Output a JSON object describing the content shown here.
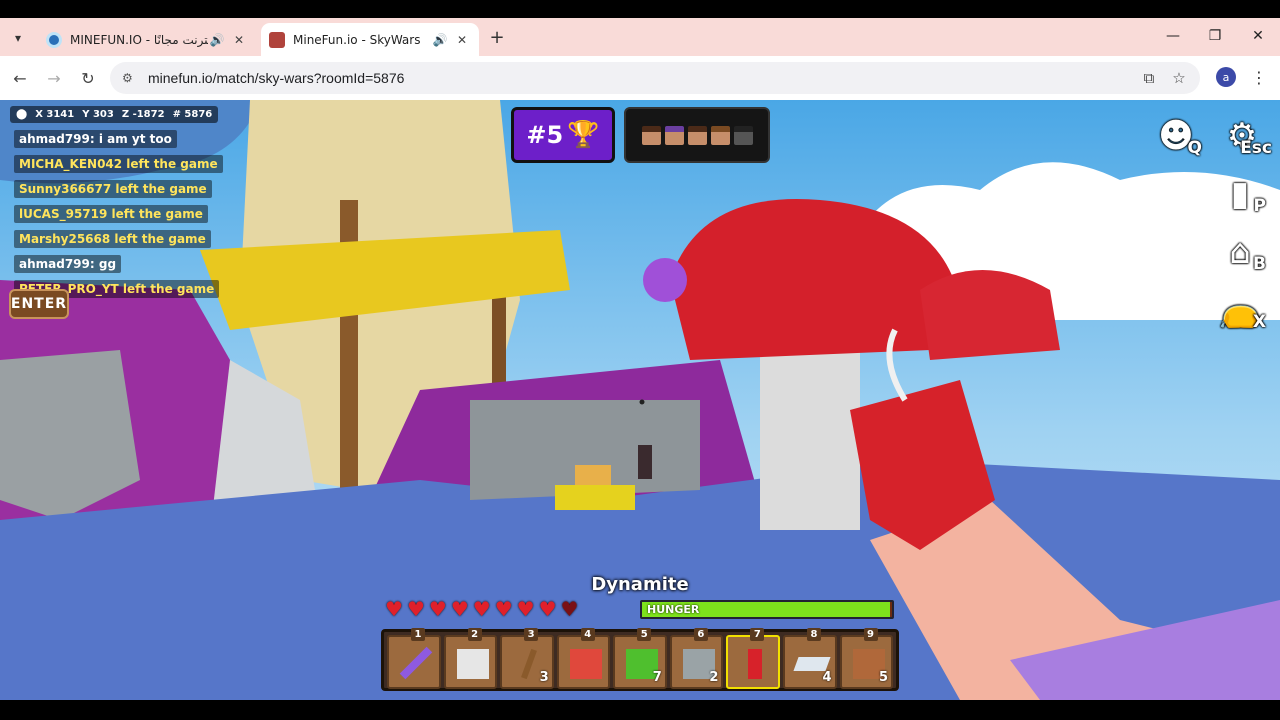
{
  "browser": {
    "tabs": [
      {
        "title": "MINEFUN.IO - الإنترنت مجانًا",
        "favicon_color": "#2a6fb7",
        "active": false
      },
      {
        "title": "MineFun.io - SkyWars",
        "favicon_color": "#b0433c",
        "active": true
      }
    ],
    "url": "minefun.io/match/sky-wars?roomId=5876",
    "profile_initial": "a"
  },
  "hud": {
    "coords": {
      "x": "X 3141",
      "y": "Y 303",
      "z": "Z -1872",
      "room": "# 5876"
    },
    "chat": [
      {
        "text": "ahmad799: i am yt too",
        "color": "white"
      },
      {
        "text": "MICHA_KEN042 left the game",
        "color": "yellow"
      },
      {
        "text": "Sunny366677 left the game",
        "color": "yellow"
      },
      {
        "text": "lUCAS_95719 left the game",
        "color": "yellow"
      },
      {
        "text": "Marshy25668 left the game",
        "color": "yellow"
      },
      {
        "text": "ahmad799: gg",
        "color": "white"
      },
      {
        "text": "PETER_PRO_YT left the game",
        "color": "yellow"
      }
    ],
    "enter_label": "ENTER",
    "rank": "#5",
    "players_remaining_icons": 5,
    "side_keys": [
      {
        "icon": "emote-icon",
        "key": "Q"
      },
      {
        "icon": "settings-gear-icon",
        "key": "Esc"
      },
      {
        "icon": "players-icon",
        "key": "P"
      },
      {
        "icon": "shop-icon",
        "key": "B"
      },
      {
        "icon": "bag-icon",
        "key": "X"
      }
    ],
    "held_item": "Dynamite",
    "health": {
      "full": 8,
      "max": 9
    },
    "hunger_label": "HUNGER",
    "hunger_level": 0.99,
    "hotbar": [
      {
        "num": "1",
        "item": "sword",
        "count": "",
        "selected": false,
        "color": "#8e5adf"
      },
      {
        "num": "2",
        "item": "cobweb-block",
        "count": "",
        "selected": false,
        "color": "#e6e6e6"
      },
      {
        "num": "3",
        "item": "stick",
        "count": "3",
        "selected": false,
        "color": "#8a5a2b"
      },
      {
        "num": "4",
        "item": "red-bed",
        "count": "",
        "selected": false,
        "color": "#e0483c"
      },
      {
        "num": "5",
        "item": "grass-block",
        "count": "7",
        "selected": false,
        "color": "#4fbf2e"
      },
      {
        "num": "6",
        "item": "stone-block",
        "count": "2",
        "selected": false,
        "color": "#9aa3a6"
      },
      {
        "num": "7",
        "item": "dynamite",
        "count": "",
        "selected": true,
        "color": "#d7222a"
      },
      {
        "num": "8",
        "item": "iron-ingot",
        "count": "4",
        "selected": false,
        "color": "#dfe7ee"
      },
      {
        "num": "9",
        "item": "dirt-block",
        "count": "5",
        "selected": false,
        "color": "#b0683a"
      }
    ]
  }
}
